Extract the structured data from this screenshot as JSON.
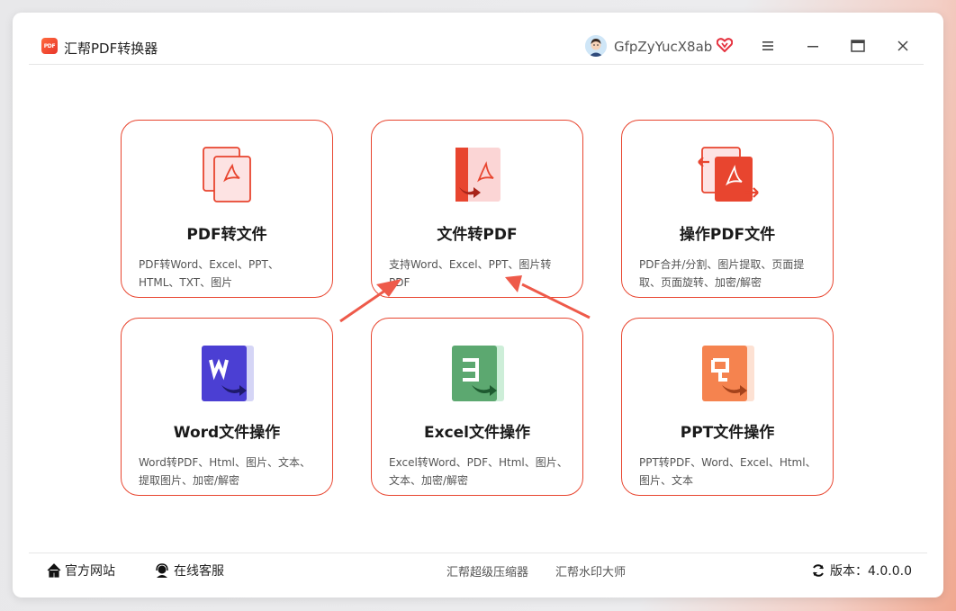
{
  "app": {
    "title": "汇帮PDF转换器",
    "logo_text": "PDF",
    "brand_color": "#e8452f"
  },
  "user": {
    "name": "GfpZyYucX8ab",
    "badge": "vip-heart-icon"
  },
  "window_controls": [
    "menu-icon",
    "minimize-icon",
    "maximize-icon",
    "close-icon"
  ],
  "cards": [
    {
      "title": "PDF转文件",
      "desc": "PDF转Word、Excel、PPT、HTML、TXT、图片",
      "icon": "pdf-to-file-icon"
    },
    {
      "title": "文件转PDF",
      "desc": "支持Word、Excel、PPT、图片转PDF",
      "icon": "file-to-pdf-icon"
    },
    {
      "title": "操作PDF文件",
      "desc": "PDF合并/分割、图片提取、页面提取、页面旋转、加密/解密",
      "icon": "pdf-operations-icon"
    },
    {
      "title": "Word文件操作",
      "desc": "Word转PDF、Html、图片、文本、提取图片、加密/解密",
      "icon": "word-icon"
    },
    {
      "title": "Excel文件操作",
      "desc": "Excel转Word、PDF、Html、图片、文本、加密/解密",
      "icon": "excel-icon"
    },
    {
      "title": "PPT文件操作",
      "desc": "PPT转PDF、Word、Excel、Html、图片、文本",
      "icon": "ppt-icon"
    }
  ],
  "footer": {
    "website": "官方网站",
    "support": "在线客服",
    "link1": "汇帮超级压缩器",
    "link2": "汇帮水印大师",
    "version": "版本：4.0.0.0"
  }
}
